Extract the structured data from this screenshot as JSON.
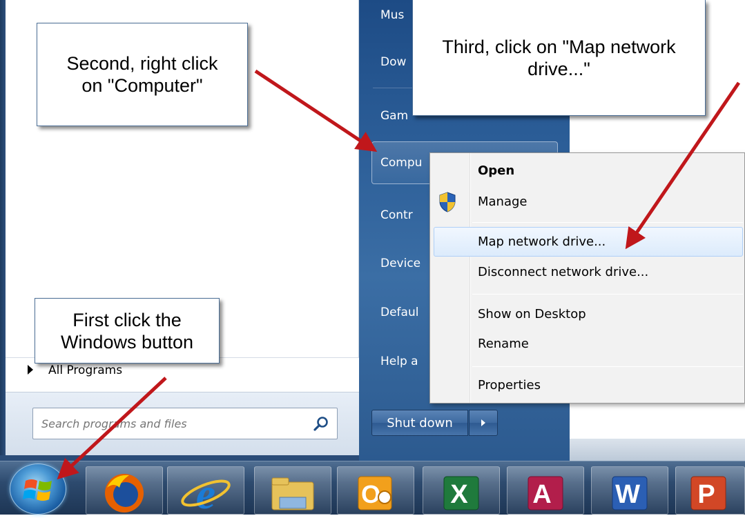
{
  "start_menu": {
    "right_items": [
      "Mus",
      "Dow",
      "Gam",
      "Compu",
      "Contr",
      "Device",
      "Defaul",
      "Help a"
    ],
    "all_programs": "All Programs",
    "search_placeholder": "Search programs and files",
    "shutdown_label": "Shut down"
  },
  "context_menu": {
    "open": "Open",
    "manage": "Manage",
    "map_network_drive": "Map network drive...",
    "disconnect_network_drive": "Disconnect network drive...",
    "show_on_desktop": "Show on Desktop",
    "rename": "Rename",
    "properties": "Properties"
  },
  "callouts": {
    "first": "First click the\nWindows button",
    "second": "Second, right click\non \"Computer\"",
    "third": "Third, click on \"Map network\ndrive...\""
  },
  "taskbar": {
    "apps": [
      {
        "icon": "windows-start-icon"
      },
      {
        "icon": "firefox-icon"
      },
      {
        "icon": "internet-explorer-icon"
      },
      {
        "icon": "file-explorer-icon"
      },
      {
        "icon": "outlook-icon",
        "glyph": "O"
      },
      {
        "icon": "excel-icon",
        "glyph": "X"
      },
      {
        "icon": "access-icon",
        "glyph": "A"
      },
      {
        "icon": "word-icon",
        "glyph": "W"
      },
      {
        "icon": "powerpoint-icon",
        "glyph": "P"
      }
    ]
  },
  "colors": {
    "arrow": "#c0171b",
    "start_panel_blue": "#2b5d97",
    "menu_highlight": "#dcebfc"
  }
}
